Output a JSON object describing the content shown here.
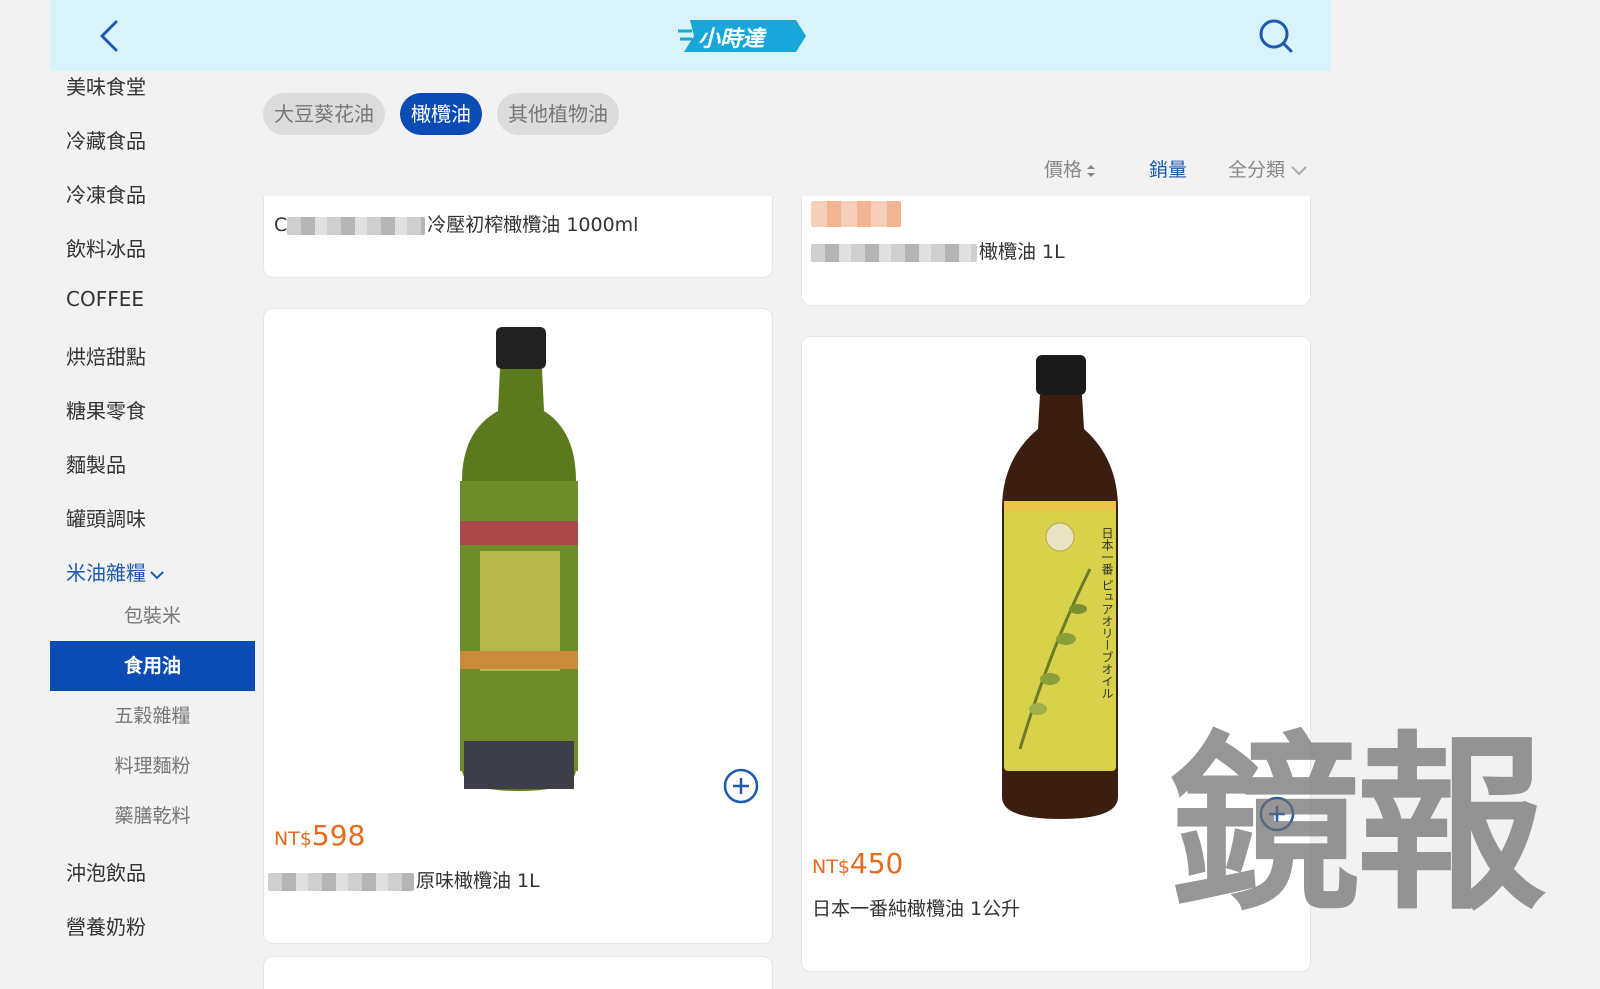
{
  "header": {
    "logo_text": "小時達"
  },
  "sidebar": {
    "categories": [
      "美味食堂",
      "冷藏食品",
      "冷凍食品",
      "飲料冰品",
      "COFFEE",
      "烘焙甜點",
      "糖果零食",
      "麵製品",
      "罐頭調味",
      "米油雜糧"
    ],
    "subcategories": [
      "包裝米",
      "食用油",
      "五穀雜糧",
      "料理麵粉",
      "藥膳乾料"
    ],
    "categories_after": [
      "沖泡飲品",
      "營養奶粉"
    ]
  },
  "filters": {
    "chips": [
      "大豆葵花油",
      "橄欖油",
      "其他植物油"
    ],
    "sort": {
      "price": "價格",
      "sales": "銷量",
      "category": "全分類"
    }
  },
  "products": [
    {
      "name_suffix": "冷壓初榨橄欖油 1000ml",
      "name_prefix_visible": "C"
    },
    {
      "name_suffix": "橄欖油 1L"
    },
    {
      "currency": "NT$",
      "price": "598",
      "name_suffix": "原味橄欖油 1L"
    },
    {
      "currency": "NT$",
      "price": "450",
      "name": "日本一番純橄欖油 1公升",
      "label_text": "日本一番 ピュアオリーブオイル"
    }
  ],
  "watermark": "鏡報",
  "colors": {
    "accent": "#0a4cb3",
    "price": "#e86a1f",
    "header_bg": "#d9f3fb"
  }
}
